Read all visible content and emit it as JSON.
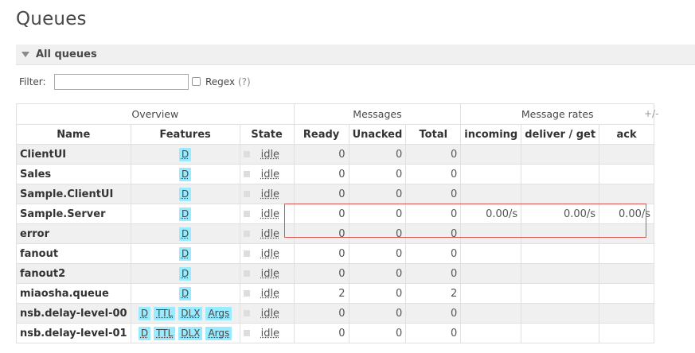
{
  "page": {
    "title": "Queues"
  },
  "section": {
    "label": "All queues"
  },
  "filter": {
    "label": "Filter:",
    "value": "",
    "regex_label": "Regex",
    "help": "(?)"
  },
  "table": {
    "groups": {
      "overview": "Overview",
      "messages": "Messages",
      "rates": "Message rates"
    },
    "toggle": "+/-",
    "columns": [
      "Name",
      "Features",
      "State",
      "Ready",
      "Unacked",
      "Total",
      "incoming",
      "deliver / get",
      "ack"
    ],
    "rows": [
      {
        "name": "ClientUI",
        "features": [
          "D"
        ],
        "state": "idle",
        "ready": "0",
        "unacked": "0",
        "total": "0",
        "incoming": "",
        "deliver": "",
        "ack": ""
      },
      {
        "name": "Sales",
        "features": [
          "D"
        ],
        "state": "idle",
        "ready": "0",
        "unacked": "0",
        "total": "0",
        "incoming": "",
        "deliver": "",
        "ack": ""
      },
      {
        "name": "Sample.ClientUI",
        "features": [
          "D"
        ],
        "state": "idle",
        "ready": "0",
        "unacked": "0",
        "total": "0",
        "incoming": "",
        "deliver": "",
        "ack": ""
      },
      {
        "name": "Sample.Server",
        "features": [
          "D"
        ],
        "state": "idle",
        "ready": "0",
        "unacked": "0",
        "total": "0",
        "incoming": "0.00/s",
        "deliver": "0.00/s",
        "ack": "0.00/s"
      },
      {
        "name": "error",
        "features": [
          "D"
        ],
        "state": "idle",
        "ready": "0",
        "unacked": "0",
        "total": "0",
        "incoming": "",
        "deliver": "",
        "ack": ""
      },
      {
        "name": "fanout",
        "features": [
          "D"
        ],
        "state": "idle",
        "ready": "0",
        "unacked": "0",
        "total": "0",
        "incoming": "",
        "deliver": "",
        "ack": ""
      },
      {
        "name": "fanout2",
        "features": [
          "D"
        ],
        "state": "idle",
        "ready": "0",
        "unacked": "0",
        "total": "0",
        "incoming": "",
        "deliver": "",
        "ack": ""
      },
      {
        "name": "miaosha.queue",
        "features": [
          "D"
        ],
        "state": "idle",
        "ready": "2",
        "unacked": "0",
        "total": "2",
        "incoming": "",
        "deliver": "",
        "ack": ""
      },
      {
        "name": "nsb.delay-level-00",
        "features": [
          "D",
          "TTL",
          "DLX",
          "Args"
        ],
        "state": "idle",
        "ready": "0",
        "unacked": "0",
        "total": "0",
        "incoming": "",
        "deliver": "",
        "ack": ""
      },
      {
        "name": "nsb.delay-level-01",
        "features": [
          "D",
          "TTL",
          "DLX",
          "Args"
        ],
        "state": "idle",
        "ready": "0",
        "unacked": "0",
        "total": "0",
        "incoming": "",
        "deliver": "",
        "ack": ""
      }
    ]
  },
  "colors": {
    "feature_badge": "#99ebff",
    "highlight_border": "#d9534f",
    "stripe": "#f0f0f0"
  }
}
